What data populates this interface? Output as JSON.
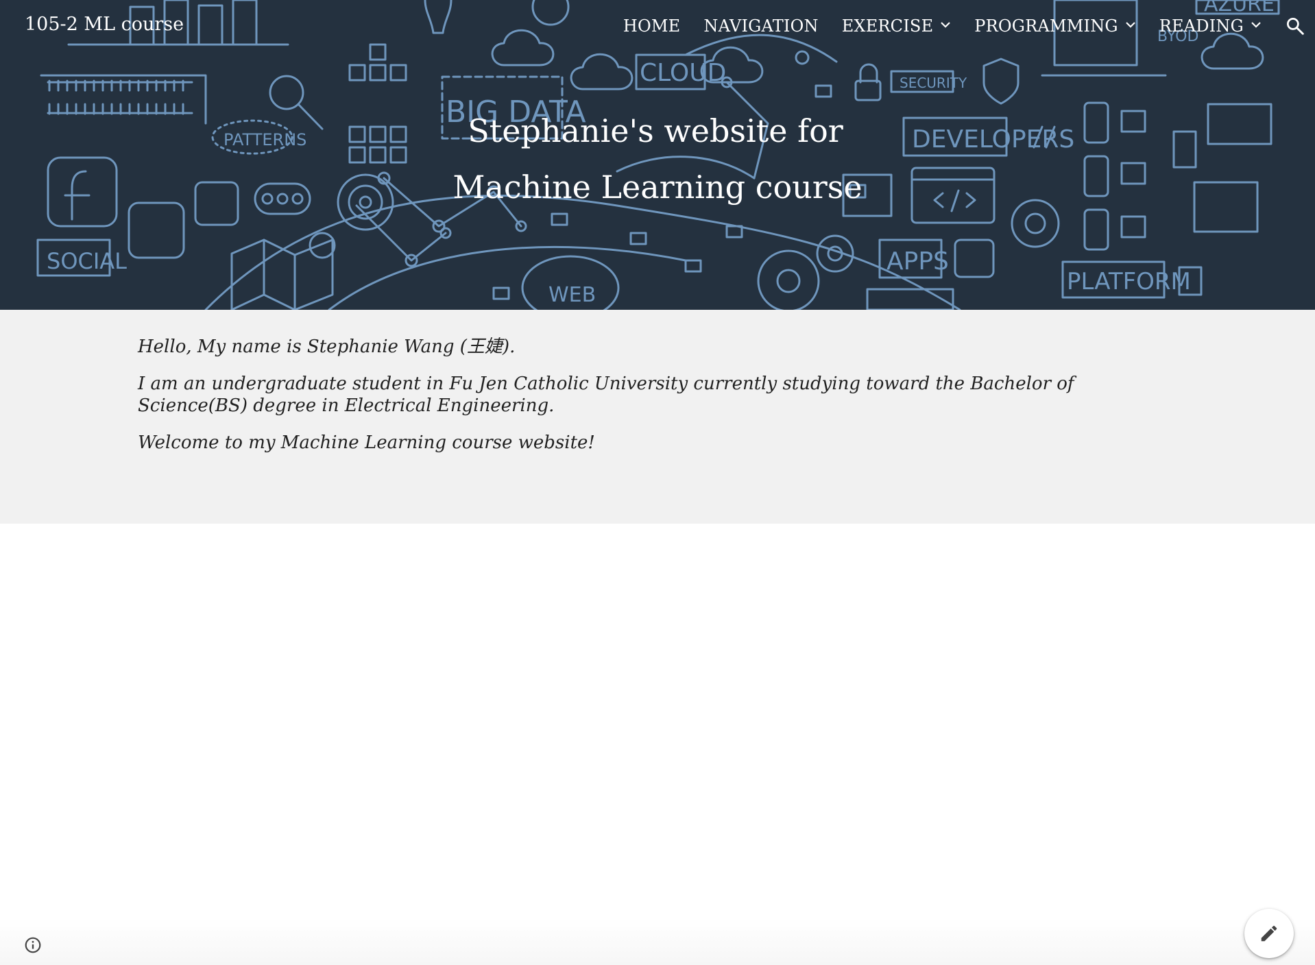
{
  "site": {
    "title": "105-2 ML course"
  },
  "nav": {
    "items": [
      {
        "label": "HOME",
        "has_dropdown": false
      },
      {
        "label": "NAVIGATION",
        "has_dropdown": false
      },
      {
        "label": "EXERCISE",
        "has_dropdown": true
      },
      {
        "label": "PROGRAMMING",
        "has_dropdown": true
      },
      {
        "label": "READING",
        "has_dropdown": true
      }
    ],
    "search_icon": "search-icon"
  },
  "hero": {
    "title_line1": "Stephanie's website for",
    "title_line2": "Machine Learning course",
    "background_color": "#24313f",
    "doodle_color": "#6f96bd",
    "doodle_labels": {
      "big_data": "BIG DATA",
      "cloud": "CLOUD",
      "patterns": "PATTERNS",
      "security": "SECURITY",
      "developers": "DEVELOPERS",
      "social": "SOCIAL",
      "apps": "APPS",
      "web": "WEB",
      "platform": "PLATFORM",
      "azure": "AZURE",
      "byod": "BYOD"
    }
  },
  "content": {
    "paragraphs": [
      "Hello, My name is Stephanie Wang (王婕).",
      "I am an undergraduate student in Fu Jen Catholic University currently studying toward the Bachelor of Science(BS) degree in Electrical Engineering.",
      "Welcome to my Machine Learning course website!"
    ],
    "background_color": "#f1f1f1"
  },
  "footer": {
    "info_icon": "info-icon",
    "edit_icon": "pencil-icon"
  }
}
